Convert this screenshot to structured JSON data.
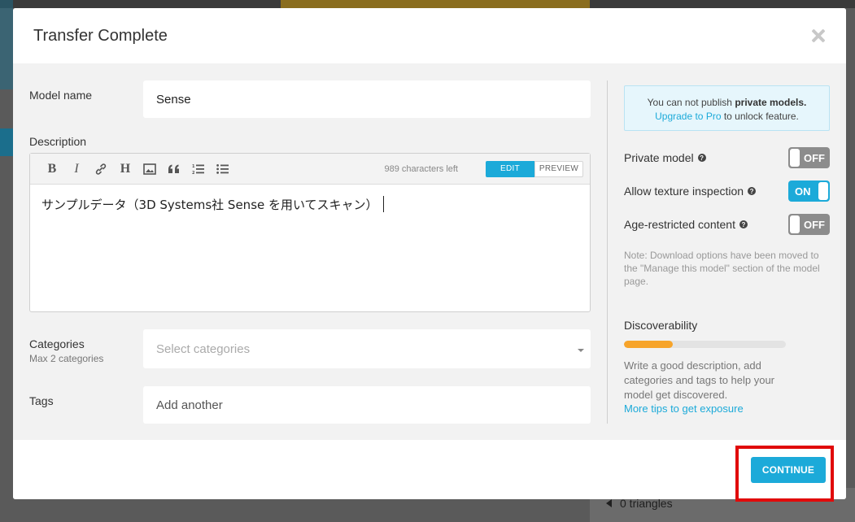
{
  "modal": {
    "title": "Transfer Complete",
    "close_icon": "close-icon"
  },
  "form": {
    "model_name_label": "Model name",
    "model_name_value": "Sense",
    "description_label": "Description",
    "toolbar": {
      "icons": [
        "bold-icon",
        "italic-icon",
        "link-icon",
        "heading-icon",
        "image-icon",
        "quote-icon",
        "ordered-list-icon",
        "unordered-list-icon"
      ],
      "chars_left": "989 characters left",
      "edit_label": "EDIT",
      "preview_label": "PREVIEW"
    },
    "description_text": "サンプルデータ（3D Systems社 Sense を用いてスキャン）",
    "categories_label": "Categories",
    "categories_sub": "Max 2 categories",
    "categories_placeholder": "Select categories",
    "tags_label": "Tags",
    "tags_placeholder": "Add another"
  },
  "sidebar": {
    "notice_prefix": "You can not publish ",
    "notice_bold": "private models.",
    "notice_link": "Upgrade to Pro",
    "notice_suffix": " to unlock feature.",
    "options": [
      {
        "label": "Private model",
        "state": "OFF"
      },
      {
        "label": "Allow texture inspection",
        "state": "ON"
      },
      {
        "label": "Age-restricted content",
        "state": "OFF"
      }
    ],
    "note": "Note: Download options have been moved to the \"Manage this model\" section of the model page.",
    "discoverability_title": "Discoverability",
    "discoverability_level": 0.3,
    "discoverability_text": "Write a good description, add categories and tags to help your model get discovered.",
    "discoverability_link": "More tips to get exposure"
  },
  "footer": {
    "continue_label": "CONTINUE"
  },
  "background": {
    "triangles_text": "0 triangles"
  },
  "colors": {
    "accent": "#1caad9",
    "progress": "#f7a42a",
    "highlight": "#e10a0a"
  }
}
